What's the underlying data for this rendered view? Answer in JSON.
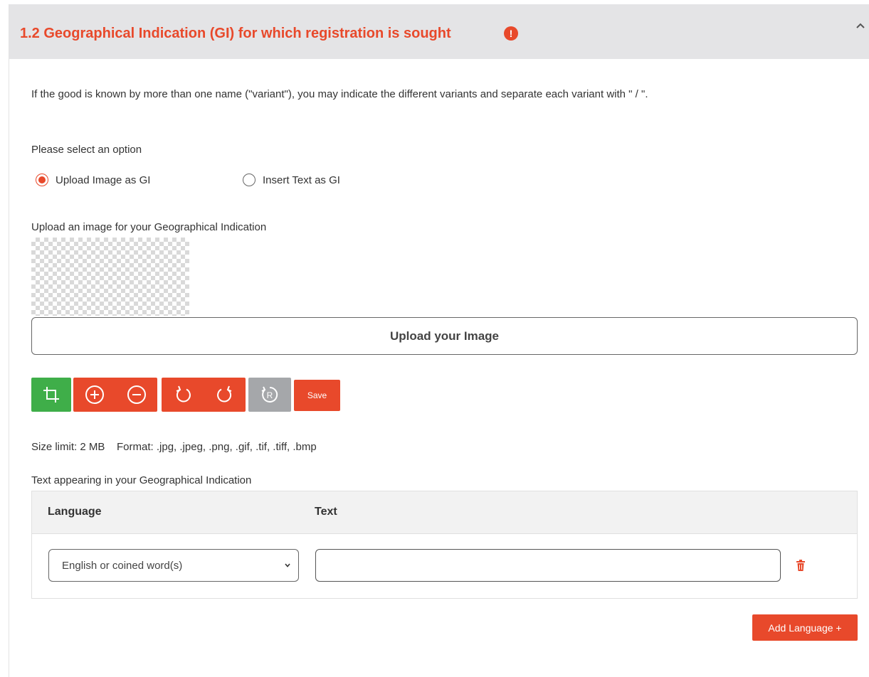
{
  "section": {
    "title": "1.2 Geographical Indication (GI) for which registration is sought",
    "alert_glyph": "!",
    "alert_icon": "exclamation-circle-icon",
    "collapse_icon": "chevron-up-icon"
  },
  "intro_text": "If the good is known by more than one name (\"variant\"), you may indicate the different variants and separate each variant with \" / \".",
  "options": {
    "label": "Please select an option",
    "items": [
      {
        "label": "Upload Image as GI",
        "checked": true
      },
      {
        "label": "Insert Text as GI",
        "checked": false
      }
    ]
  },
  "upload": {
    "label": "Upload an image for your Geographical Indication",
    "button_label": "Upload your Image"
  },
  "toolbar": {
    "crop_icon": "crop-icon",
    "zoom_in_icon": "zoom-in-icon",
    "zoom_out_icon": "zoom-out-icon",
    "rotate_left_icon": "rotate-left-icon",
    "rotate_right_icon": "rotate-right-icon",
    "reset_icon": "reset-icon",
    "reset_glyph": "R",
    "save_label": "Save"
  },
  "limits_text": "Size limit: 2 MB    Format: .jpg, .jpeg, .png, .gif, .tif, .tiff, .bmp",
  "text_section": {
    "label": "Text appearing in your Geographical Indication",
    "columns": [
      "Language",
      "Text"
    ],
    "rows": [
      {
        "language": "English or coined word(s)",
        "text": ""
      }
    ],
    "delete_icon": "trash-icon"
  },
  "add_language_label": "Add Language +",
  "colors": {
    "accent": "#e8492b",
    "crop_green": "#3fae49",
    "reset_gray": "#a5a7aa",
    "header_bg": "#e4e4e6"
  }
}
